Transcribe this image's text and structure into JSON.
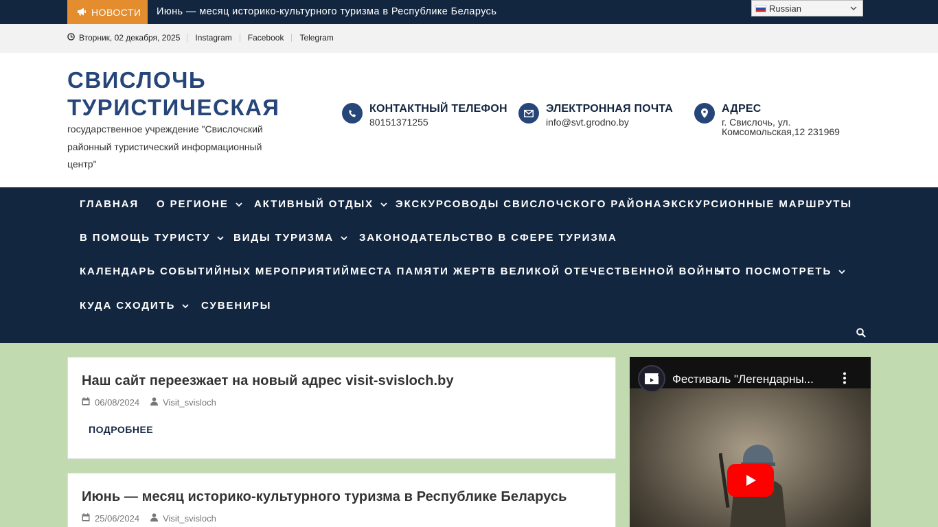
{
  "topbar": {
    "news_label": "НОВОСТИ",
    "news_ticker": "Июнь — месяц историко-культурного туризма в Республике Беларусь",
    "language": "Russian"
  },
  "infobar": {
    "date": "Вторник, 02 декабря, 2025",
    "social": [
      "Instagram",
      "Facebook",
      "Telegram"
    ]
  },
  "header": {
    "title_line1": "СВИСЛОЧЬ",
    "title_line2": "ТУРИСТИЧЕСКАЯ",
    "description": "государственное учреждение \"Свислочский районный туристический информационный центр\"",
    "contacts": [
      {
        "title": "КОНТАКТНЫЙ ТЕЛЕФОН",
        "value": "80151371255",
        "icon": "phone-icon"
      },
      {
        "title": "ЭЛЕКТРОННАЯ ПОЧТА",
        "value": "info@svt.grodno.by",
        "icon": "envelope-icon"
      },
      {
        "title": "АДРЕС",
        "value_line1": "г. Свислочь, ул.",
        "value_line2": "Комсомольская,12 231969",
        "icon": "map-pin-icon"
      }
    ]
  },
  "nav": {
    "items": [
      {
        "label": "ГЛАВНАЯ",
        "dropdown": false
      },
      {
        "label": "О РЕГИОНЕ",
        "dropdown": true
      },
      {
        "label": "АКТИВНЫЙ ОТДЫХ",
        "dropdown": true
      },
      {
        "label": "ЭКСКУРСОВОДЫ СВИСЛОЧСКОГО РАЙОНА",
        "dropdown": false
      },
      {
        "label": "ЭКСКУРСИОННЫЕ МАРШРУТЫ",
        "dropdown": false
      },
      {
        "label": "В ПОМОЩЬ ТУРИСТУ",
        "dropdown": true
      },
      {
        "label": "ВИДЫ ТУРИЗМА",
        "dropdown": true
      },
      {
        "label": "ЗАКОНОДАТЕЛЬСТВО В СФЕРЕ ТУРИЗМА",
        "dropdown": false
      },
      {
        "label": "КАЛЕНДАРЬ СОБЫТИЙНЫХ МЕРОПРИЯТИЙ",
        "dropdown": false
      },
      {
        "label": "МЕСТА ПАМЯТИ ЖЕРТВ ВЕЛИКОЙ ОТЕЧЕСТВЕННОЙ ВОЙНЫ",
        "dropdown": false
      },
      {
        "label": "ЧТО ПОСМОТРЕТЬ",
        "dropdown": true
      },
      {
        "label": "КУДА СХОДИТЬ",
        "dropdown": true
      },
      {
        "label": "СУВЕНИРЫ",
        "dropdown": false
      }
    ]
  },
  "posts": [
    {
      "title": "Наш сайт переезжает на новый адрес visit-svisloch.by",
      "date": "06/08/2024",
      "author": "Visit_svisloch",
      "read_more": "ПОДРОБНЕЕ"
    },
    {
      "title": "Июнь — месяц историко-культурного туризма в Республике Беларусь",
      "date": "25/06/2024",
      "author": "Visit_svisloch"
    }
  ],
  "video": {
    "title": "Фестиваль \"Легендарны..."
  },
  "colors": {
    "navy": "#132640",
    "title_blue": "#26467a",
    "accent_orange": "#e48d2e",
    "page_green": "#c2dab0",
    "youtube_red": "#ff0000"
  }
}
